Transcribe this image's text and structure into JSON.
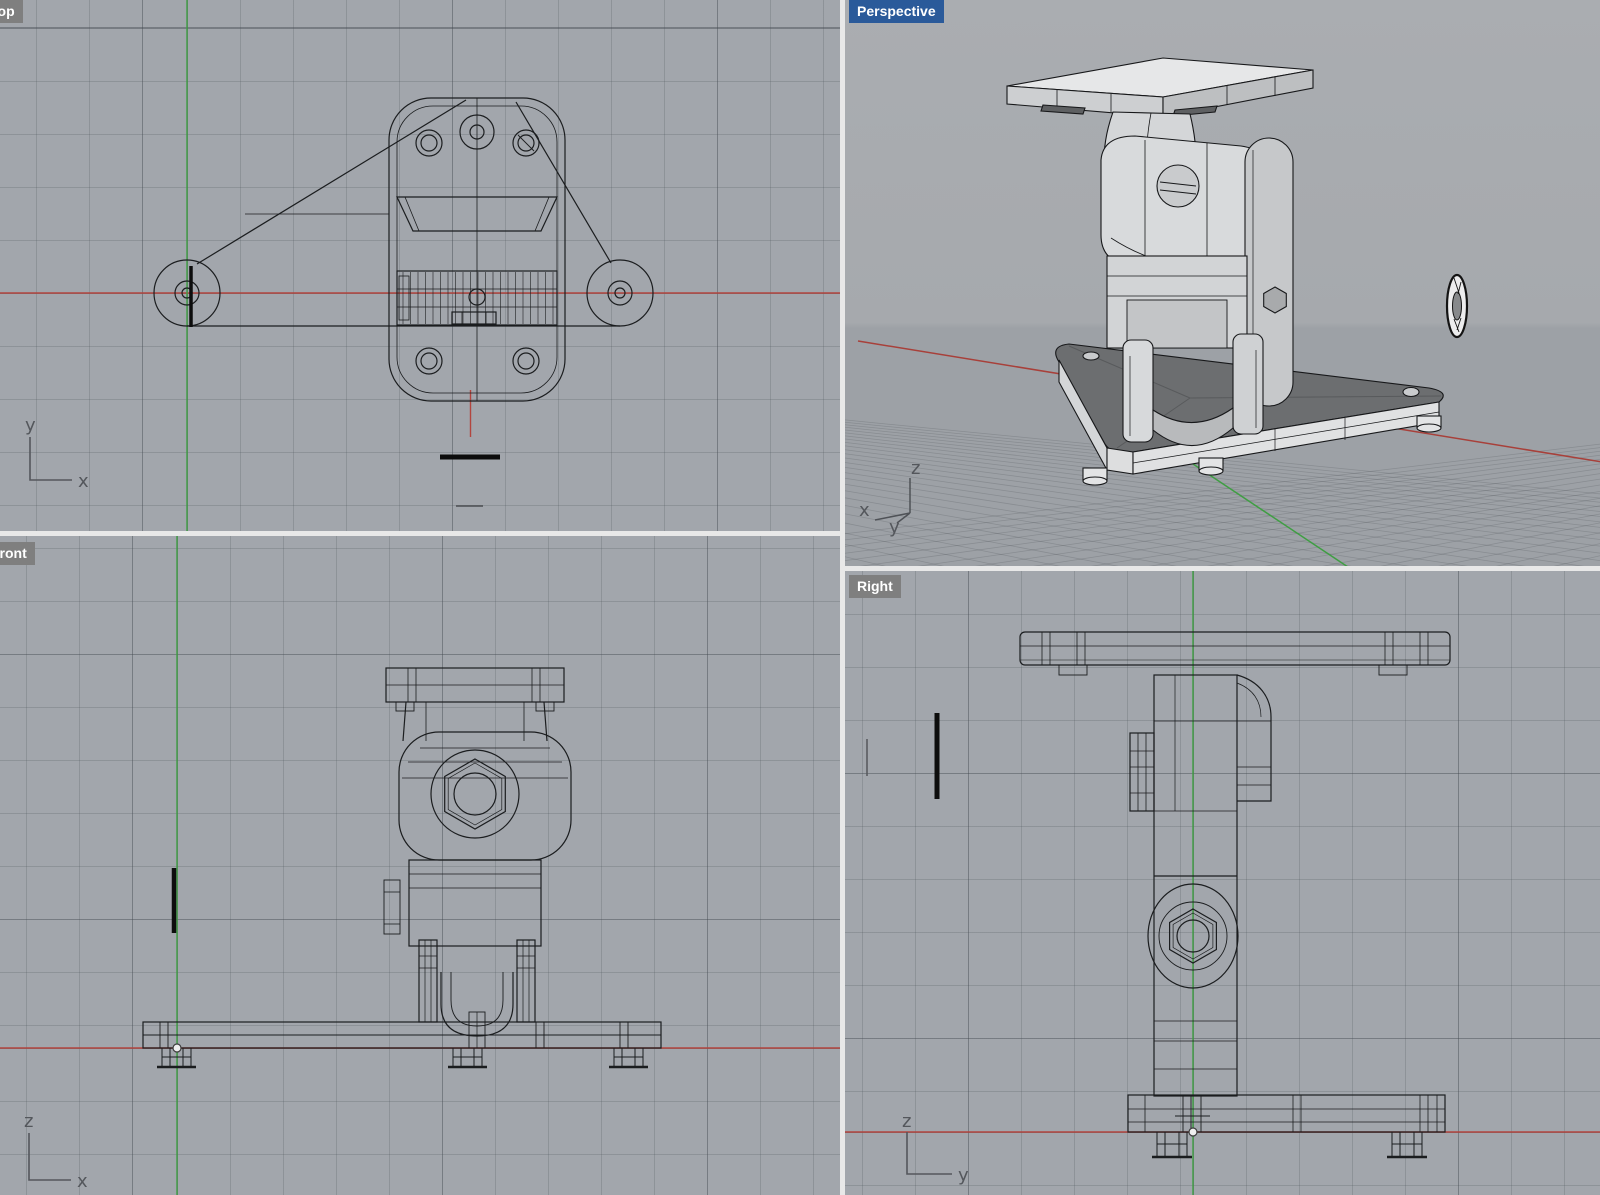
{
  "viewports": {
    "top": {
      "label": "Top"
    },
    "perspective": {
      "label": "Perspective"
    },
    "front": {
      "label": "Front"
    },
    "right": {
      "label": "Right"
    }
  },
  "active_viewport": "Perspective",
  "axis_gizmos": {
    "top": {
      "up": "y",
      "right": "x"
    },
    "front": {
      "up": "z",
      "right": "x"
    },
    "right": {
      "up": "z",
      "right": "y"
    },
    "perspective": {
      "up": "z",
      "left": "x",
      "mid": "y"
    }
  },
  "colors": {
    "viewport_background": "#a2a6ac",
    "grid_minor": "#8f939a",
    "grid_major": "#85898f",
    "axis_x_red": "#b2453e",
    "axis_y_green": "#3f9e43",
    "wireframe": "#1b1d1f",
    "active_label_background": "#2a5a9a",
    "inactive_label_background": "#7f7f7f",
    "label_text": "#ffffff",
    "divider": "#e8e8e8",
    "shaded_light": "#d9dbdd",
    "shaded_dark": "#6d6f71"
  }
}
